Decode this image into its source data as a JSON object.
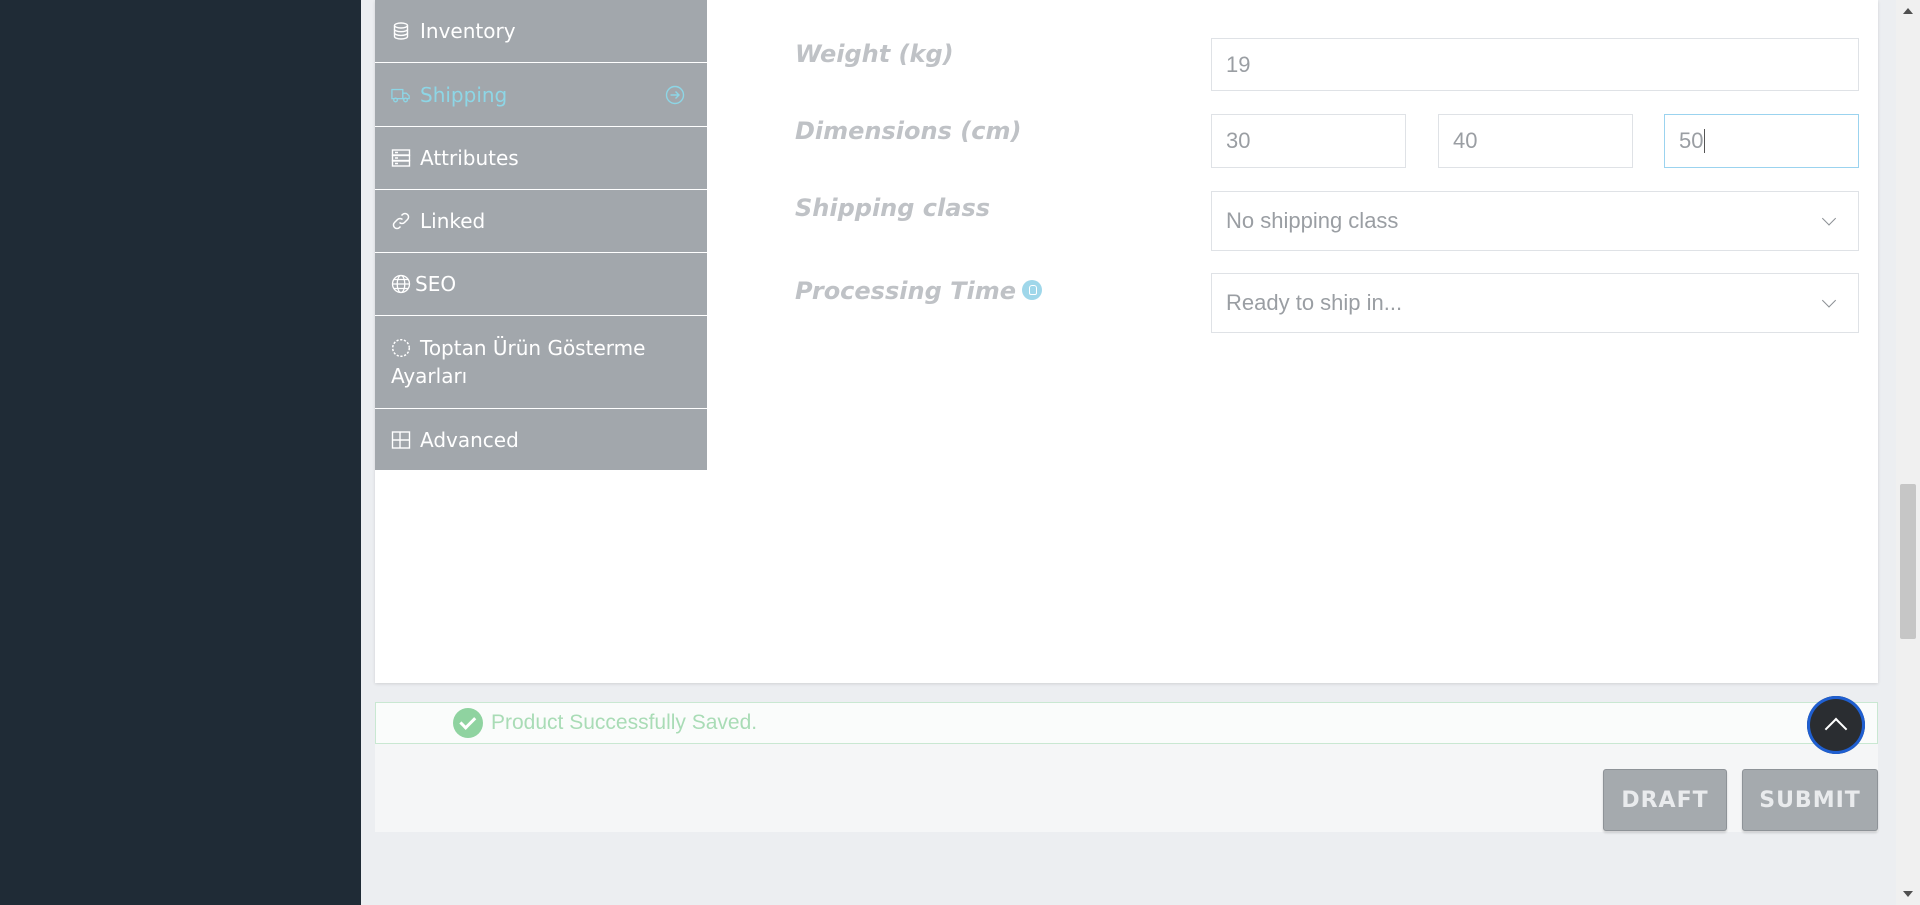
{
  "tabs": [
    {
      "label": "Inventory",
      "icon": "database-icon",
      "active": false
    },
    {
      "label": "Shipping",
      "icon": "truck-icon",
      "active": true
    },
    {
      "label": "Attributes",
      "icon": "server-icon",
      "active": false
    },
    {
      "label": "Linked",
      "icon": "link-icon",
      "active": false
    },
    {
      "label": "SEO",
      "icon": "globe-icon",
      "active": false
    },
    {
      "label_line1": "Toptan Ürün Gösterme",
      "label_line2": "Ayarları",
      "icon": "circle-dashed-icon",
      "active": false
    },
    {
      "label": "Advanced",
      "icon": "grid-icon",
      "active": false
    }
  ],
  "shipping": {
    "weight_label": "Weight (kg)",
    "weight_value": "19",
    "dimensions_label": "Dimensions (cm)",
    "length": "30",
    "width": "40",
    "height": "50",
    "shipping_class_label": "Shipping class",
    "shipping_class_value": "No shipping class",
    "processing_time_label": "Processing Time",
    "processing_time_value": "Ready to ship in..."
  },
  "notice": {
    "message": "Product Successfully Saved."
  },
  "actions": {
    "draft_label": "DRAFT",
    "submit_label": "SUBMIT"
  },
  "colors": {
    "sidebar_dark": "#1f2b36",
    "tab_bg": "#a2a7ac",
    "active_tab_text": "#8dd6e6",
    "success": "#8fd3a0"
  }
}
